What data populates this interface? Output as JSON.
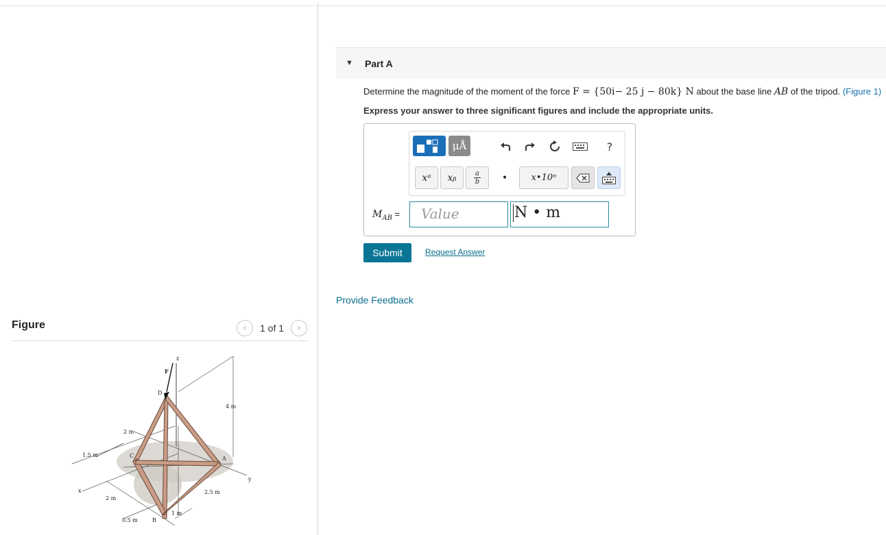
{
  "figure_panel": {
    "title": "Figure",
    "counter": "1 of 1",
    "prev_icon": "chevron-left-icon",
    "next_icon": "chevron-right-icon",
    "diagram_labels": {
      "z": "z",
      "F": "F",
      "D": "D",
      "C": "C",
      "A": "A",
      "B": "B",
      "x": "x",
      "y": "y",
      "dim_4m": "4 m",
      "dim_2m_top": "2 m",
      "dim_1_5m": "1.5 m",
      "dim_2m_bottom": "2 m",
      "dim_0_5m": "0.5 m",
      "dim_1m": "1 m",
      "dim_2_5m": "2.5 m"
    }
  },
  "part": {
    "label": "Part A",
    "question": {
      "prefix": "Determine the magnitude of the moment of the force ",
      "math": "F = {50i− 25 j − 80k} N",
      "middle": " about the base line ",
      "line": "AB",
      "suffix": " of the tripod. ",
      "figure_link": "(Figure 1)"
    },
    "instruction": "Express your answer to three significant figures and include the appropriate units."
  },
  "toolbar": {
    "units_button": "μÅ",
    "undo_icon": "undo-icon",
    "redo_icon": "redo-icon",
    "reset_icon": "reset-icon",
    "keyboard_icon": "keyboard-icon",
    "help": "?",
    "superscript": "xᵃ",
    "subscript": "xᵦ",
    "fraction_num": "a",
    "fraction_den": "b",
    "dot": "•",
    "sci_notation": "x•10ⁿ",
    "backspace_icon": "backspace-icon",
    "keyboard_toggle_icon": "keyboard-toggle-icon"
  },
  "answer": {
    "lhs_var": "M",
    "lhs_sub": "AB",
    "lhs_eq": " =",
    "value_placeholder": "Value",
    "units_value": "N • m"
  },
  "actions": {
    "submit": "Submit",
    "request_answer": "Request Answer",
    "feedback": "Provide Feedback"
  },
  "colors": {
    "accent": "#0b7596",
    "link": "#0b6e8d",
    "template_blue": "#1b6fb8",
    "input_border": "#2a8ba3"
  }
}
